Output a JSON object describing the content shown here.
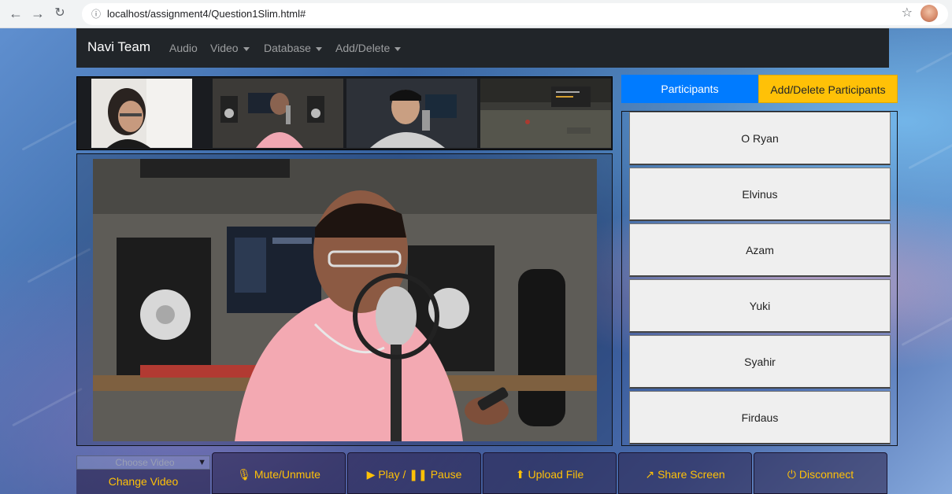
{
  "browser": {
    "url": "localhost/assignment4/Question1Slim.html#"
  },
  "navbar": {
    "brand": "Navi Team",
    "links": [
      {
        "label": "Audio",
        "dropdown": false
      },
      {
        "label": "Video",
        "dropdown": true
      },
      {
        "label": "Database",
        "dropdown": true
      },
      {
        "label": "Add/Delete",
        "dropdown": true
      }
    ]
  },
  "tabs": {
    "participants": "Participants",
    "add_delete": "Add/Delete Participants"
  },
  "participants": [
    "O Ryan",
    "Elvinus",
    "Azam",
    "Yuki",
    "Syahir",
    "Firdaus"
  ],
  "controls": {
    "select_placeholder": "Choose Video",
    "change_video": "Change Video",
    "mute": "Mute/Unmute",
    "play": "Play / ",
    "pause": "Pause",
    "upload": "Upload File",
    "share": "Share Screen",
    "disconnect": "Disconnect"
  },
  "colors": {
    "primary": "#007bff",
    "warning": "#ffc107",
    "navbar": "#212529"
  },
  "icons": [
    "back-icon",
    "forward-icon",
    "reload-icon",
    "info-icon",
    "star-icon",
    "microphone-icon",
    "play-icon",
    "pause-icon",
    "upload-icon",
    "share-icon",
    "power-icon"
  ]
}
